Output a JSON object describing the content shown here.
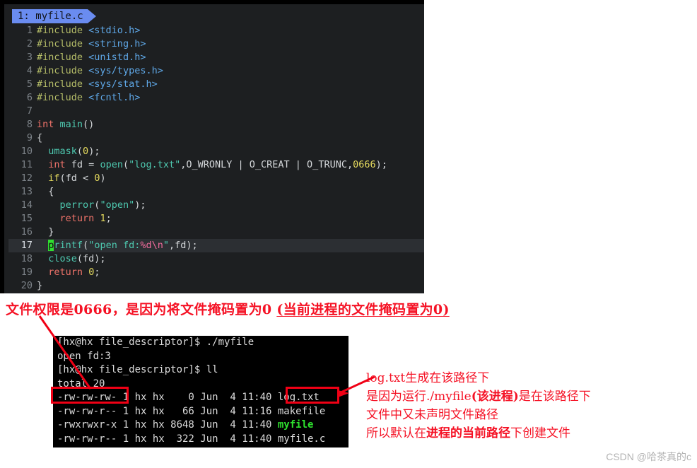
{
  "editor": {
    "tab": {
      "label": "1: myfile.c"
    },
    "lines": [
      {
        "n": "1",
        "tokens": [
          {
            "t": "pre",
            "s": "#include"
          },
          {
            "t": "pln",
            "s": " "
          },
          {
            "t": "hdr",
            "s": "<stdio.h>"
          }
        ]
      },
      {
        "n": "2",
        "tokens": [
          {
            "t": "pre",
            "s": "#include"
          },
          {
            "t": "pln",
            "s": " "
          },
          {
            "t": "hdr",
            "s": "<string.h>"
          }
        ]
      },
      {
        "n": "3",
        "tokens": [
          {
            "t": "pre",
            "s": "#include"
          },
          {
            "t": "pln",
            "s": " "
          },
          {
            "t": "hdr",
            "s": "<unistd.h>"
          }
        ]
      },
      {
        "n": "4",
        "tokens": [
          {
            "t": "pre",
            "s": "#include"
          },
          {
            "t": "pln",
            "s": " "
          },
          {
            "t": "hdr",
            "s": "<sys/types.h>"
          }
        ]
      },
      {
        "n": "5",
        "tokens": [
          {
            "t": "pre",
            "s": "#include"
          },
          {
            "t": "pln",
            "s": " "
          },
          {
            "t": "hdr",
            "s": "<sys/stat.h>"
          }
        ]
      },
      {
        "n": "6",
        "tokens": [
          {
            "t": "pre",
            "s": "#include"
          },
          {
            "t": "pln",
            "s": " "
          },
          {
            "t": "hdr",
            "s": "<fcntl.h>"
          }
        ]
      },
      {
        "n": "7",
        "tokens": []
      },
      {
        "n": "8",
        "tokens": [
          {
            "t": "kw",
            "s": "int"
          },
          {
            "t": "pln",
            "s": " "
          },
          {
            "t": "fn",
            "s": "main"
          },
          {
            "t": "pln",
            "s": "()"
          }
        ]
      },
      {
        "n": "9",
        "tokens": [
          {
            "t": "pln",
            "s": "{"
          }
        ]
      },
      {
        "n": "10",
        "tokens": [
          {
            "t": "pln",
            "s": "  "
          },
          {
            "t": "fn",
            "s": "umask"
          },
          {
            "t": "pln",
            "s": "("
          },
          {
            "t": "num",
            "s": "0"
          },
          {
            "t": "pln",
            "s": ");"
          }
        ]
      },
      {
        "n": "11",
        "tokens": [
          {
            "t": "pln",
            "s": "  "
          },
          {
            "t": "kw",
            "s": "int"
          },
          {
            "t": "pln",
            "s": " fd = "
          },
          {
            "t": "fn",
            "s": "open"
          },
          {
            "t": "pln",
            "s": "("
          },
          {
            "t": "str",
            "s": "\"log.txt\""
          },
          {
            "t": "pln",
            "s": ",O_WRONLY | O_CREAT | O_TRUNC,"
          },
          {
            "t": "num",
            "s": "0666"
          },
          {
            "t": "pln",
            "s": ");"
          }
        ]
      },
      {
        "n": "12",
        "tokens": [
          {
            "t": "pln",
            "s": "  "
          },
          {
            "t": "kw2",
            "s": "if"
          },
          {
            "t": "pln",
            "s": "(fd < "
          },
          {
            "t": "num",
            "s": "0"
          },
          {
            "t": "pln",
            "s": ")"
          }
        ]
      },
      {
        "n": "13",
        "tokens": [
          {
            "t": "pln",
            "s": "  {"
          }
        ]
      },
      {
        "n": "14",
        "tokens": [
          {
            "t": "pln",
            "s": "    "
          },
          {
            "t": "fn",
            "s": "perror"
          },
          {
            "t": "pln",
            "s": "("
          },
          {
            "t": "str",
            "s": "\"open\""
          },
          {
            "t": "pln",
            "s": ");"
          }
        ]
      },
      {
        "n": "15",
        "tokens": [
          {
            "t": "pln",
            "s": "    "
          },
          {
            "t": "kw",
            "s": "return"
          },
          {
            "t": "pln",
            "s": " "
          },
          {
            "t": "num",
            "s": "1"
          },
          {
            "t": "pln",
            "s": ";"
          }
        ]
      },
      {
        "n": "16",
        "tokens": [
          {
            "t": "pln",
            "s": "  }"
          }
        ]
      },
      {
        "n": "17",
        "current": true,
        "tokens": [
          {
            "t": "pln",
            "s": "  "
          },
          {
            "t": "cursor",
            "s": "p"
          },
          {
            "t": "fn",
            "s": "rintf"
          },
          {
            "t": "pln",
            "s": "("
          },
          {
            "t": "str",
            "s": "\"open fd:"
          },
          {
            "t": "esc",
            "s": "%d\\n"
          },
          {
            "t": "str",
            "s": "\""
          },
          {
            "t": "pln",
            "s": ",fd);"
          }
        ]
      },
      {
        "n": "18",
        "tokens": [
          {
            "t": "pln",
            "s": "  "
          },
          {
            "t": "fn",
            "s": "close"
          },
          {
            "t": "pln",
            "s": "(fd);"
          }
        ]
      },
      {
        "n": "19",
        "tokens": [
          {
            "t": "pln",
            "s": "  "
          },
          {
            "t": "kw",
            "s": "return"
          },
          {
            "t": "pln",
            "s": " "
          },
          {
            "t": "num",
            "s": "0"
          },
          {
            "t": "pln",
            "s": ";"
          }
        ]
      },
      {
        "n": "20",
        "tokens": [
          {
            "t": "pln",
            "s": "}"
          }
        ]
      }
    ]
  },
  "annotation_top": {
    "plain": "文件权限是0666，是因为将文件掩码置为0 ",
    "underlined": "(当前进程的文件掩码置为0)"
  },
  "terminal": {
    "lines": [
      {
        "segs": [
          {
            "s": "[hx@hx file_descriptor]$ ./myfile"
          }
        ]
      },
      {
        "segs": [
          {
            "s": "open fd:3"
          }
        ]
      },
      {
        "segs": [
          {
            "s": "[hx@hx file_descriptor]$ ll"
          }
        ]
      },
      {
        "segs": [
          {
            "s": "total 20"
          }
        ]
      },
      {
        "segs": [
          {
            "s": "-rw-rw-rw- 1 hx hx    0 Jun  4 11:40 log.txt"
          }
        ]
      },
      {
        "segs": [
          {
            "s": "-rw-rw-r-- 1 hx hx   66 Jun  4 11:16 makefile"
          }
        ]
      },
      {
        "segs": [
          {
            "s": "-rwxrwxr-x 1 hx hx 8648 Jun  4 11:40 "
          },
          {
            "s": "myfile",
            "c": "green"
          }
        ]
      },
      {
        "segs": [
          {
            "s": "-rw-rw-r-- 1 hx hx  322 Jun  4 11:40 myfile.c"
          }
        ]
      }
    ]
  },
  "annotation_right": {
    "line1": "log.txt生成在该路径下",
    "line2_a": "是因为运行./myfile",
    "line2_b": "(该进程)",
    "line2_c": "是在该路径下",
    "line3": "文件中又未声明文件路径",
    "line4_a": "所以默认在",
    "line4_b": "进程的当前路径",
    "line4_c": "下创建文件"
  },
  "watermark": {
    "text": "CSDN @哈茶真的c"
  },
  "colors": {
    "annotation_red": "#f51225",
    "box_red": "#f00015",
    "editor_bg": "#1d1f21",
    "terminal_bg": "#000000",
    "tab_blue": "#6a8cf0",
    "cursor_green": "#30e030",
    "exec_green": "#2ee02e"
  }
}
